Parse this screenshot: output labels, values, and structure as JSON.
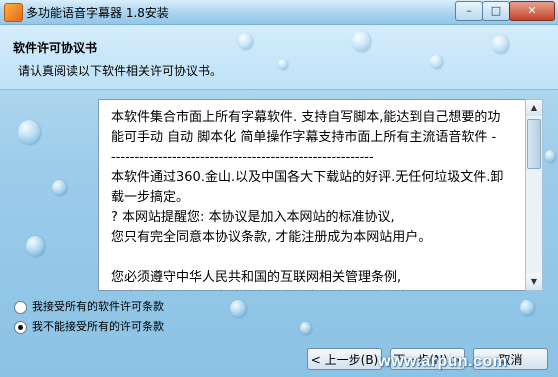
{
  "window": {
    "title": "多功能语音字幕器 1.8安装",
    "min_label": "–",
    "max_label": "□",
    "close_label": "✕"
  },
  "header": {
    "title": "软件许可协议书",
    "subtitle": "请认真阅读以下软件相关许可协议书。"
  },
  "license": {
    "text": "本软件集合市面上所有字幕软件. 支持自写脚本,能达到自己想要的功\n能可手动 自动 脚本化 简单操作字幕支持市面上所有主流语音软件 -\n--------------------------------------------------------\n本软件通过360.金山.以及中国各大下载站的好评.无任何垃圾文件.卸\n载一步搞定。\n? 本网站提醒您: 本协议是加入本网站的标准协议,\n您只有完全同意本协议条款, 才能注册成为本网站用户。\n\n您必须遵守中华人民共和国的互联网相关管理条例,\n其中包括不得利用本站危害国家安全、泄露国家秘密,"
  },
  "options": {
    "accept": "我接受所有的软件许可条款",
    "decline": "我不能接受所有的许可条款",
    "selected": "decline"
  },
  "buttons": {
    "back": "< 上一步(B)",
    "next": "下一步(N) >",
    "cancel": "取消"
  },
  "watermark": "www.arpun.com",
  "colors": {
    "background": "#9cccea",
    "header": "#c9e7f9",
    "close_button": "#c4442b"
  }
}
